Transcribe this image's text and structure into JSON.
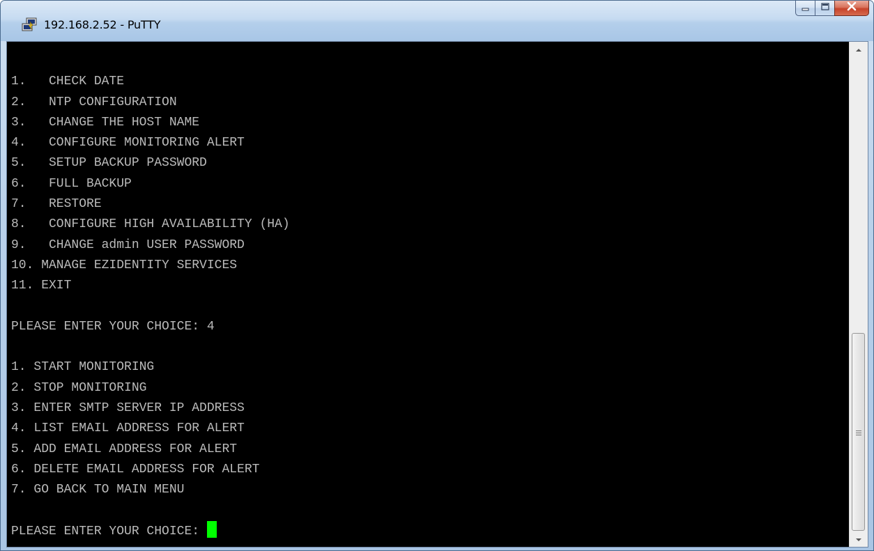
{
  "window": {
    "title": "192.168.2.52 - PuTTY",
    "icon": "putty-computer-icon",
    "controls": {
      "minimize_icon": "minimize-icon",
      "maximize_icon": "maximize-icon",
      "close_icon": "close-icon"
    }
  },
  "terminal": {
    "lines": [
      "",
      "1.   CHECK DATE",
      "2.   NTP CONFIGURATION",
      "3.   CHANGE THE HOST NAME",
      "4.   CONFIGURE MONITORING ALERT",
      "5.   SETUP BACKUP PASSWORD",
      "6.   FULL BACKUP",
      "7.   RESTORE",
      "8.   CONFIGURE HIGH AVAILABILITY (HA)",
      "9.   CHANGE admin USER PASSWORD",
      "10. MANAGE EZIDENTITY SERVICES",
      "11. EXIT",
      "",
      "PLEASE ENTER YOUR CHOICE: 4",
      "",
      "1. START MONITORING",
      "2. STOP MONITORING",
      "3. ENTER SMTP SERVER IP ADDRESS",
      "4. LIST EMAIL ADDRESS FOR ALERT",
      "5. ADD EMAIL ADDRESS FOR ALERT",
      "6. DELETE EMAIL ADDRESS FOR ALERT",
      "7. GO BACK TO MAIN MENU",
      ""
    ],
    "prompt": "PLEASE ENTER YOUR CHOICE: ",
    "text_color": "#bbbbbb",
    "background_color": "#000000",
    "cursor_color": "#00ff00"
  }
}
